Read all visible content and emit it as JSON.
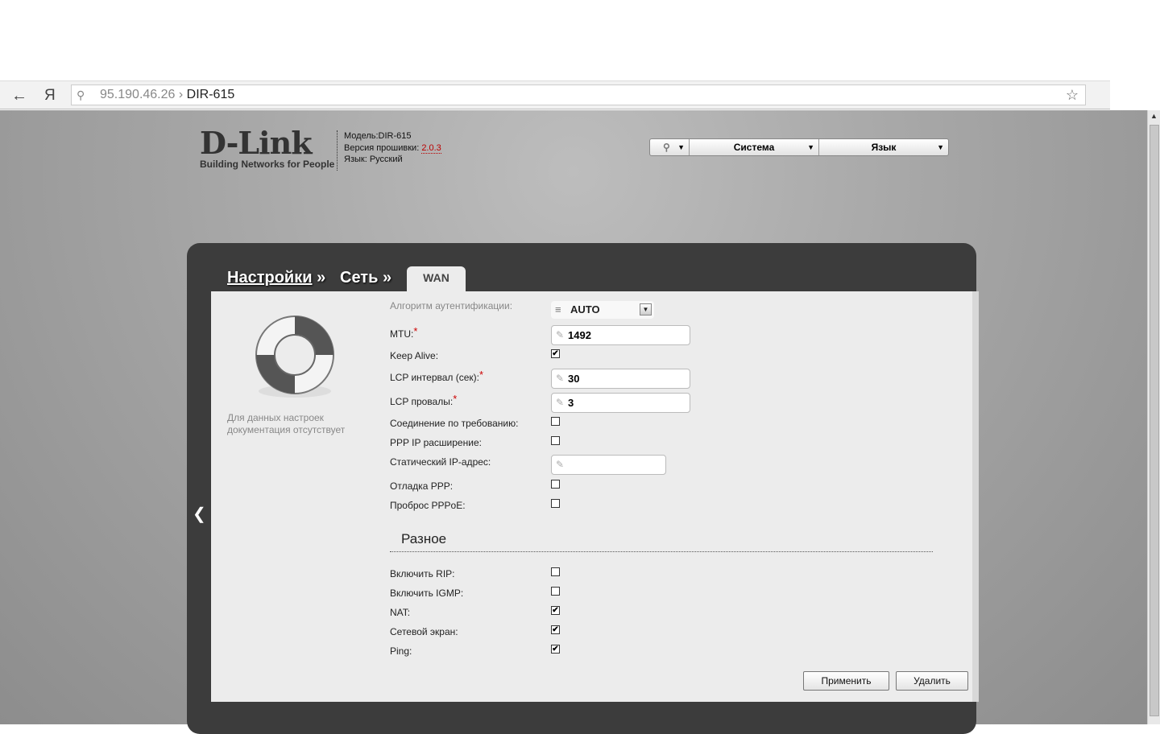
{
  "browser": {
    "host": "95.190.46.26",
    "separator": "›",
    "page": "DIR-615",
    "yandex": "Я"
  },
  "header": {
    "logo": "D-Link",
    "tagline": "Building Networks for People",
    "model_label": "Модель:",
    "model": "DIR-615",
    "fw_label": "Версия прошивки: ",
    "fw": "2.0.3",
    "lang_label": "Язык: ",
    "lang": "Русский"
  },
  "menu": {
    "system": "Система",
    "language": "Язык"
  },
  "breadcrumb": {
    "settings": "Настройки",
    "network": "Сеть",
    "sep": "»",
    "tab": "WAN"
  },
  "doc": "Для данных настроек документация отсутствует",
  "form": {
    "auth_label": "Алгоритм аутентификации:",
    "auth_value": "AUTO",
    "mtu_label": "MTU:",
    "mtu_value": "1492",
    "keepalive_label": "Keep Alive:",
    "lcp_interval_label": "LCP интервал (сек):",
    "lcp_interval_value": "30",
    "lcp_fail_label": "LCP провалы:",
    "lcp_fail_value": "3",
    "on_demand_label": "Соединение по требованию:",
    "ppp_ip_label": "PPP IP расширение:",
    "static_ip_label": "Статический IP-адрес:",
    "static_ip_value": "",
    "debug_label": "Отладка PPP:",
    "pppoe_label": "Проброс PPPoE:"
  },
  "misc": {
    "title": "Разное",
    "rip": "Включить RIP:",
    "igmp": "Включить IGMP:",
    "nat": "NAT:",
    "firewall": "Сетевой экран:",
    "ping": "Ping:"
  },
  "checks": {
    "keepalive": true,
    "on_demand": false,
    "ppp_ip": false,
    "debug": false,
    "pppoe": false,
    "rip": false,
    "igmp": false,
    "nat": true,
    "firewall": true,
    "ping": true
  },
  "buttons": {
    "apply": "Применить",
    "delete": "Удалить"
  },
  "required_mark": "*"
}
